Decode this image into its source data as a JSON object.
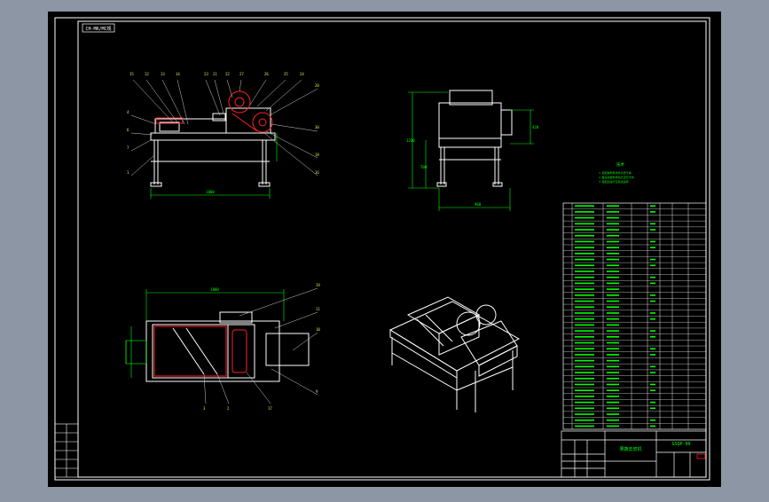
{
  "drawing": {
    "title_tag": "CH-MR/MC规",
    "notes_heading": "技术",
    "notes": [
      "1.装配前所有零件清洗干净",
      "2.各运动部件转动灵活无卡滞",
      "3.装配后进行空载试运转"
    ],
    "title_block": {
      "name": "果蔬去皮机",
      "drawing_no": "GSQP-00"
    }
  },
  "colors": {
    "background": "#000000",
    "frame": "#ffffff",
    "line": "#ffffff",
    "dimension": "#00ff00",
    "highlight": "#ff2020",
    "leader": "#cfcfcf",
    "label": "#e8e850"
  },
  "views": [
    "front-view",
    "side-view",
    "top-view",
    "isometric-view"
  ]
}
